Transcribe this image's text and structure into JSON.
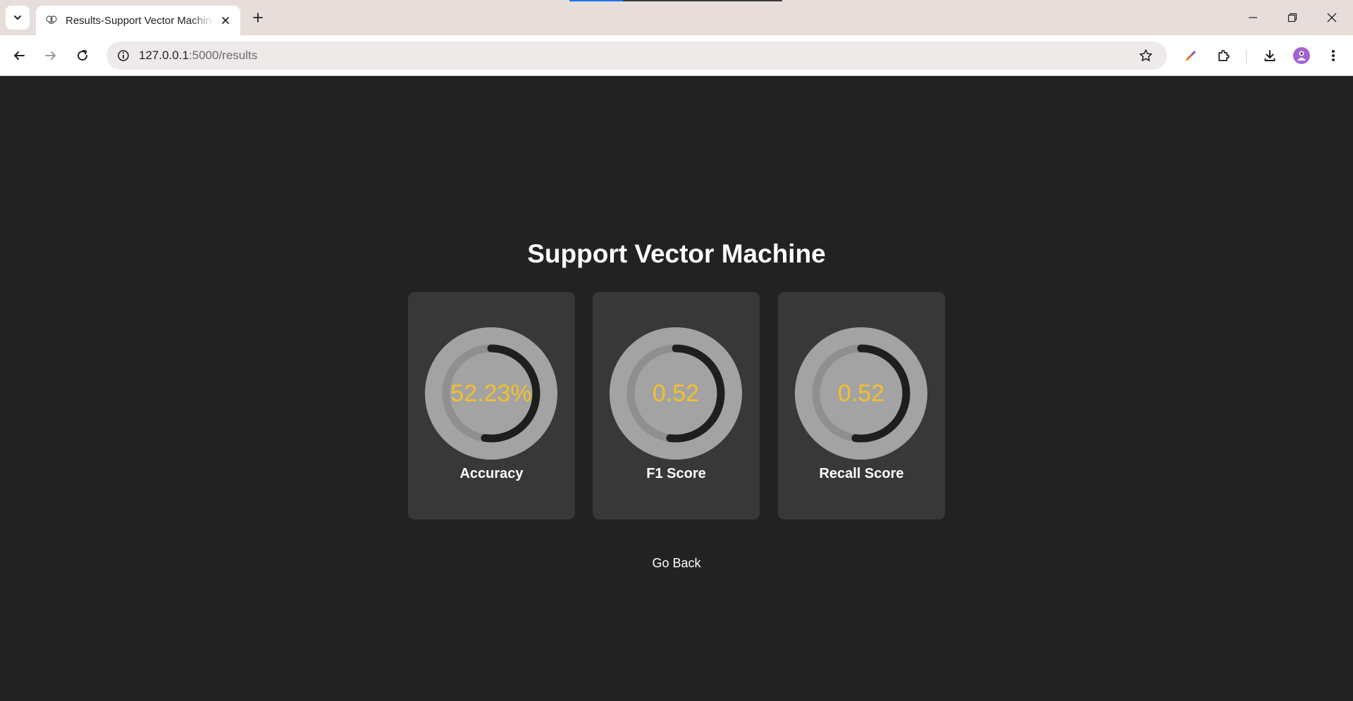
{
  "browser": {
    "tab_title": "Results-Support Vector Machine",
    "url_host": "127.0.0.1",
    "url_rest": ":5000/results",
    "loading_progress": 0.25,
    "icons": [
      "chevron-down-icon",
      "brain-icon",
      "close-icon",
      "plus-icon",
      "minimize-icon",
      "restore-icon",
      "close-window-icon",
      "back-icon",
      "forward-icon",
      "reload-icon",
      "info-icon",
      "star-icon",
      "color-picker-icon",
      "extensions-icon",
      "download-icon",
      "avatar-icon",
      "more-vert-icon"
    ]
  },
  "page": {
    "title": "Support Vector Machine",
    "metrics": [
      {
        "display": "52.23%",
        "label": "Accuracy",
        "value": 0.5223
      },
      {
        "display": "0.52",
        "label": "F1 Score",
        "value": 0.52
      },
      {
        "display": "0.52",
        "label": "Recall Score",
        "value": 0.52
      }
    ],
    "go_back_label": "Go Back"
  },
  "colors": {
    "background": "#222222",
    "card": "#383838",
    "gauge_track": "#8f8f8f",
    "gauge_face": "#a3a3a3",
    "gauge_progress": "#1e1e1e",
    "value_text": "#f3c02a",
    "title_text": "#ffffff"
  }
}
